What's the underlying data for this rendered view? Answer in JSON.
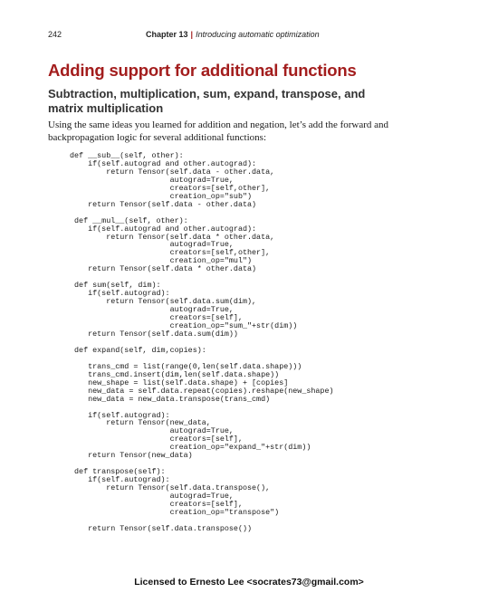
{
  "header": {
    "page_number": "242",
    "chapter_label": "Chapter 13",
    "chapter_title": "Introducing automatic optimization"
  },
  "section": {
    "title": "Adding support for additional functions",
    "subtitle": "Subtraction, multiplication, sum, expand, transpose, and matrix multiplication",
    "intro": "Using the same ideas you learned for addition and negation, let’s add the forward and backpropagation logic for several additional functions:"
  },
  "code": "def __sub__(self, other):\n    if(self.autograd and other.autograd):\n        return Tensor(self.data - other.data,\n                      autograd=True,\n                      creators=[self,other],\n                      creation_op=\"sub\")\n    return Tensor(self.data - other.data)\n\n def __mul__(self, other):\n    if(self.autograd and other.autograd):\n        return Tensor(self.data * other.data,\n                      autograd=True,\n                      creators=[self,other],\n                      creation_op=\"mul\")\n    return Tensor(self.data * other.data)\n\n def sum(self, dim):\n    if(self.autograd):\n        return Tensor(self.data.sum(dim),\n                      autograd=True,\n                      creators=[self],\n                      creation_op=\"sum_\"+str(dim))\n    return Tensor(self.data.sum(dim))\n\n def expand(self, dim,copies):\n\n    trans_cmd = list(range(0,len(self.data.shape)))\n    trans_cmd.insert(dim,len(self.data.shape))\n    new_shape = list(self.data.shape) + [copies]\n    new_data = self.data.repeat(copies).reshape(new_shape)\n    new_data = new_data.transpose(trans_cmd)\n\n    if(self.autograd):\n        return Tensor(new_data,\n                      autograd=True,\n                      creators=[self],\n                      creation_op=\"expand_\"+str(dim))\n    return Tensor(new_data)\n\n def transpose(self):\n    if(self.autograd):\n        return Tensor(self.data.transpose(),\n                      autograd=True,\n                      creators=[self],\n                      creation_op=\"transpose\")\n\n    return Tensor(self.data.transpose())",
  "footer": "Licensed to Ernesto Lee <socrates73@gmail.com>"
}
